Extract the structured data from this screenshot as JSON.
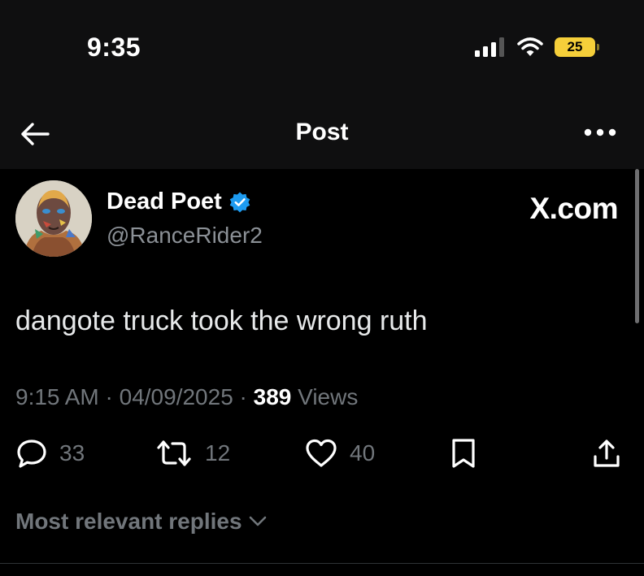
{
  "status_bar": {
    "time": "9:35",
    "battery_level": "25"
  },
  "nav": {
    "title": "Post"
  },
  "post": {
    "author": {
      "display_name": "Dead Poet",
      "handle": "@RanceRider2",
      "verified": true
    },
    "watermark": "X.com",
    "text": "dangote truck took the wrong ruth",
    "meta": {
      "time": "9:15 AM",
      "separator": "·",
      "date": "04/09/2025",
      "views_count": "389",
      "views_label": "Views"
    },
    "actions": {
      "replies": "33",
      "reposts": "12",
      "likes": "40"
    }
  },
  "replies_section": {
    "label": "Most relevant replies"
  },
  "colors": {
    "verified_badge": "#1d9bf0",
    "background": "#000000",
    "muted_text": "#71767b"
  }
}
